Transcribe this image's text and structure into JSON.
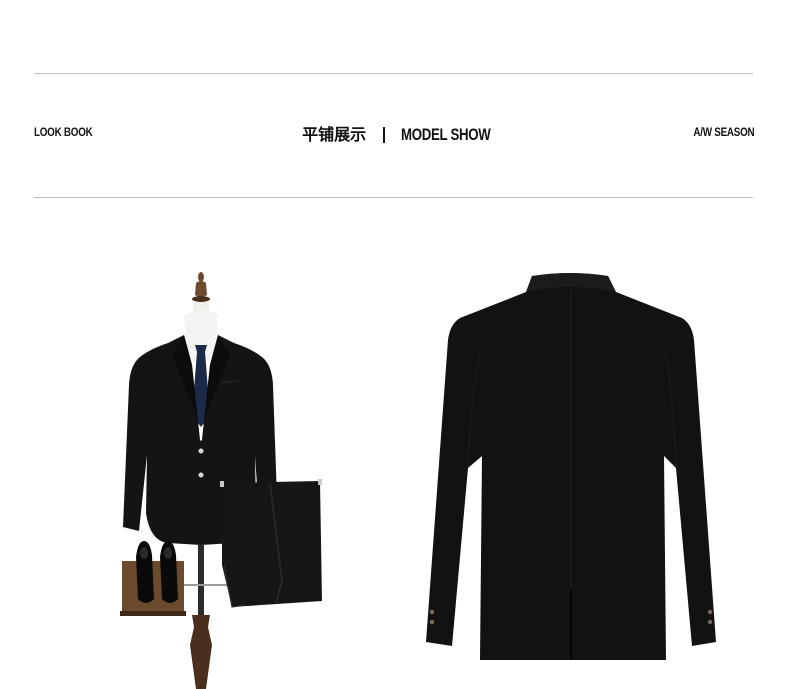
{
  "banner": {
    "left_label": "LOOK BOOK",
    "title_cn": "平铺展示",
    "title_en": "MODEL SHOW",
    "right_label": "A/W SEASON"
  },
  "colors": {
    "rule": "#bdbdbd",
    "text": "#111111",
    "suit": "#111111",
    "tie": "#1c2a4a",
    "wood": "#5a3a22"
  },
  "images": {
    "front": "suit-front-on-mannequin",
    "back": "suit-jacket-back-view"
  }
}
